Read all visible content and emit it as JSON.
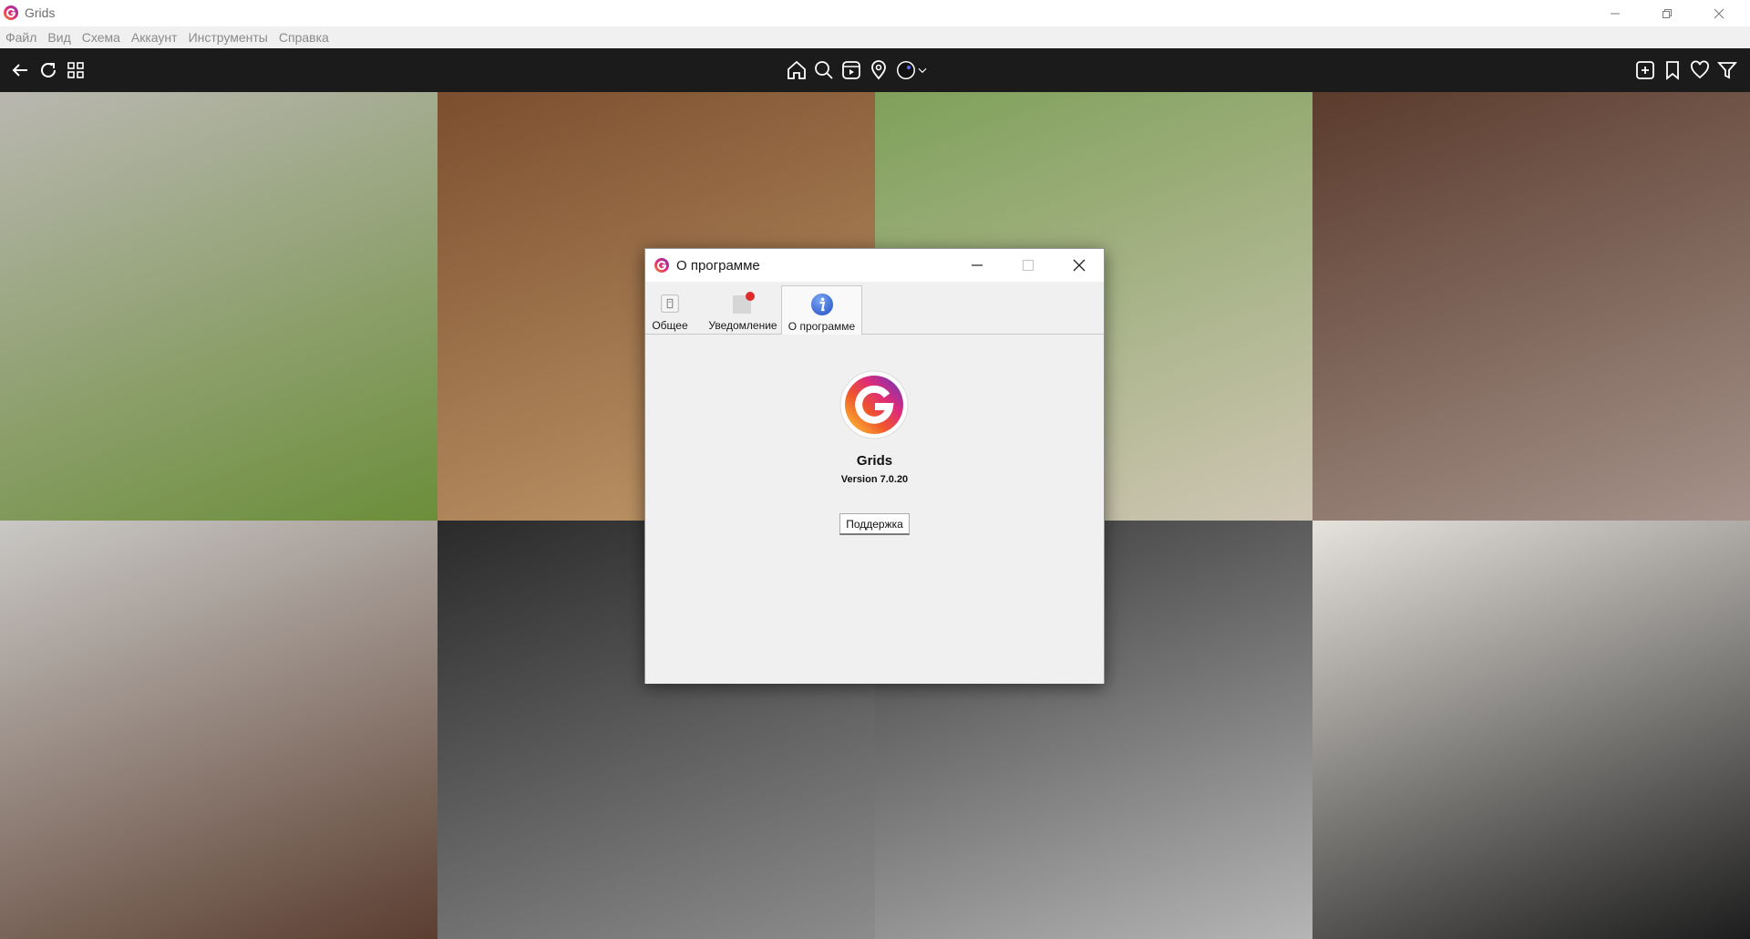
{
  "window": {
    "title": "Grids"
  },
  "menu": [
    "Файл",
    "Вид",
    "Схема",
    "Аккаунт",
    "Инструменты",
    "Справка"
  ],
  "toolbar": {
    "left": [
      "back-arrow-icon",
      "refresh-icon",
      "grid-view-icon"
    ],
    "center": [
      "home-icon",
      "search-icon",
      "reels-icon",
      "location-icon",
      "account-avatar-icon",
      "chevron-down-icon"
    ],
    "right": [
      "new-post-icon",
      "bookmark-icon",
      "heart-icon",
      "filter-icon"
    ]
  },
  "grid": {
    "tiles": [
      {
        "name": "photo-woman-on-lawn",
        "colors": [
          "#b9b7b0",
          "#6c8e3a"
        ]
      },
      {
        "name": "photo-man-with-glasses-bookshelf",
        "colors": [
          "#7b4f2e",
          "#c19a6b"
        ]
      },
      {
        "name": "photo-horse-rider-jumping",
        "colors": [
          "#7fa05a",
          "#cfc6b4"
        ]
      },
      {
        "name": "photo-two-men-selfie",
        "colors": [
          "#5a3b2c",
          "#a5928a"
        ]
      },
      {
        "name": "photo-woman-leather-pants",
        "colors": [
          "#c9c8c5",
          "#5b3e30"
        ]
      },
      {
        "name": "photo-mini-car-detail",
        "colors": [
          "#2a2a2a",
          "#8c8c8c"
        ]
      },
      {
        "name": "photo-woman-black-and-white",
        "colors": [
          "#3a3a3a",
          "#b5b5b5"
        ]
      },
      {
        "name": "photo-woman-white-blouse",
        "colors": [
          "#e6e2dc",
          "#1d1d1d"
        ]
      }
    ]
  },
  "dialog": {
    "title": "О программе",
    "tabs": [
      {
        "label": "Общее",
        "icon": "general-settings-icon"
      },
      {
        "label": "Уведомление",
        "icon": "notification-icon"
      },
      {
        "label": "О программе",
        "icon": "info-icon"
      }
    ],
    "app_name": "Grids",
    "version": "Version 7.0.20",
    "support_label": "Поддержка"
  },
  "colors": {
    "accent": "#3b6fd4",
    "notification_dot": "#e02b2b",
    "logo_gradient": [
      "#f58529",
      "#dd2a7b",
      "#8134af"
    ]
  }
}
